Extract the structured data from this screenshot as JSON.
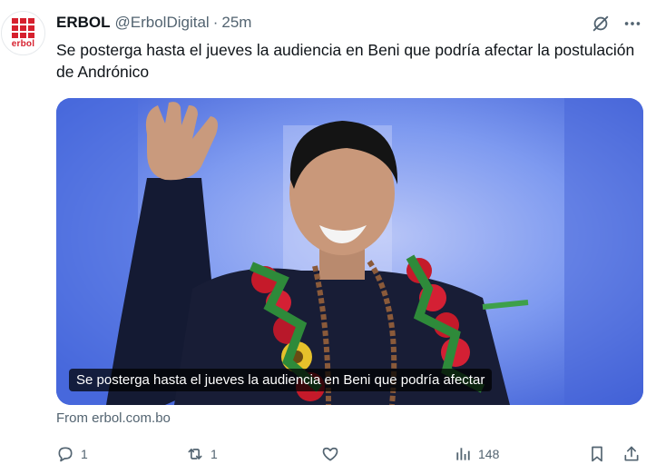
{
  "post": {
    "author_name": "ERBOL",
    "handle": "@ErbolDigital",
    "separator": "·",
    "time": "25m",
    "text": "Se posterga hasta el jueves la audiencia en Beni que podría afectar la postulación de Andrónico",
    "avatar_text": "erbol",
    "avatar_icon": "erbol-logo",
    "accent_color": "#d6202e"
  },
  "card": {
    "caption": "Se posterga hasta el jueves la audiencia en Beni que podría afectar",
    "source": "From erbol.com.bo"
  },
  "actions": {
    "replies": "1",
    "reposts": "1",
    "likes": "",
    "views": "148"
  },
  "icons": {
    "grok": "grok-icon",
    "more": "more-icon",
    "reply": "reply-icon",
    "repost": "repost-icon",
    "like": "heart-icon",
    "views": "views-icon",
    "bookmark": "bookmark-icon",
    "share": "share-icon"
  },
  "colors": {
    "text": "#0f1419",
    "secondary": "#536471"
  }
}
